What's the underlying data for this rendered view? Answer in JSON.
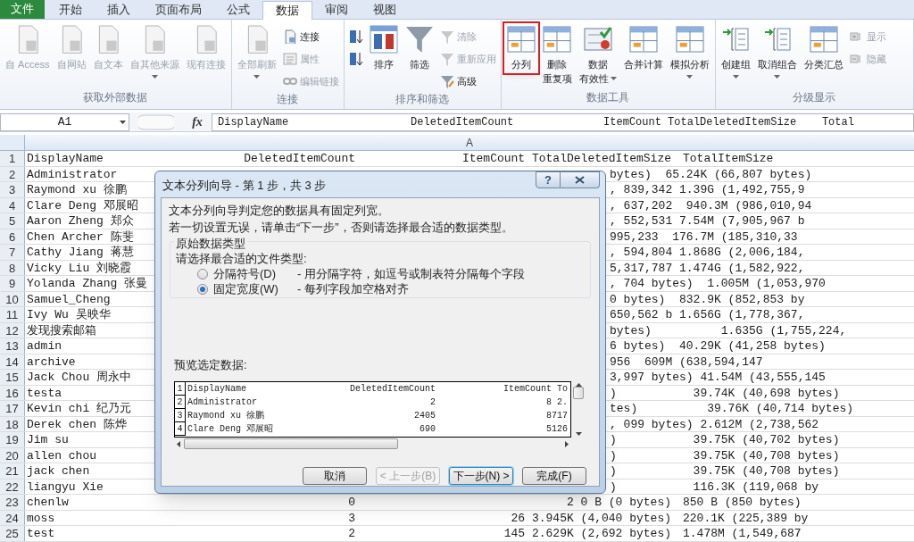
{
  "tabs": [
    {
      "label": "文件",
      "kind": "file",
      "selected": false
    },
    {
      "label": "开始",
      "kind": "tab",
      "selected": false
    },
    {
      "label": "插入",
      "kind": "tab",
      "selected": false
    },
    {
      "label": "页面布局",
      "kind": "tab",
      "selected": false
    },
    {
      "label": "公式",
      "kind": "tab",
      "selected": false
    },
    {
      "label": "数据",
      "kind": "tab",
      "selected": true
    },
    {
      "label": "审阅",
      "kind": "tab",
      "selected": false
    },
    {
      "label": "视图",
      "kind": "tab",
      "selected": false
    }
  ],
  "ribbon_groups": [
    {
      "label": "获取外部数据",
      "buttons": [
        {
          "lines": [
            "自 Access"
          ],
          "kind": "large",
          "disabled": true
        },
        {
          "lines": [
            "自网站"
          ],
          "kind": "large",
          "disabled": true
        },
        {
          "lines": [
            "自文本"
          ],
          "kind": "large",
          "disabled": true
        },
        {
          "lines": [
            "自其他来源"
          ],
          "kind": "large",
          "disabled": true,
          "dropdown": true
        },
        {
          "lines": [
            "现有连接"
          ],
          "kind": "large",
          "disabled": true
        }
      ]
    },
    {
      "label": "连接",
      "buttons": [
        {
          "lines": [
            "全部刷新"
          ],
          "kind": "large",
          "disabled": true,
          "dropdown": true
        },
        {
          "lines": [
            "连接"
          ],
          "kind": "small",
          "disabled": false
        },
        {
          "lines": [
            "属性"
          ],
          "kind": "small",
          "disabled": true
        },
        {
          "lines": [
            "编辑链接"
          ],
          "kind": "small",
          "disabled": true
        }
      ]
    },
    {
      "label": "排序和筛选",
      "buttons": [
        {
          "kind": "small",
          "disabled": false
        },
        {
          "kind": "small",
          "disabled": false
        },
        {
          "lines": [
            "排序"
          ],
          "kind": "large",
          "disabled": false
        },
        {
          "lines": [
            "筛选"
          ],
          "kind": "large",
          "disabled": false
        },
        {
          "lines": [
            "清除"
          ],
          "kind": "small",
          "disabled": true
        },
        {
          "lines": [
            "重新应用"
          ],
          "kind": "small",
          "disabled": true
        },
        {
          "lines": [
            "高级"
          ],
          "kind": "small",
          "disabled": false
        }
      ]
    },
    {
      "label": "数据工具",
      "buttons": [
        {
          "lines": [
            "分列"
          ],
          "kind": "large",
          "disabled": false,
          "highlighted": true
        },
        {
          "lines": [
            "删除",
            "重复项"
          ],
          "kind": "large",
          "disabled": false
        },
        {
          "lines": [
            "数据",
            "有效性"
          ],
          "kind": "large",
          "disabled": false,
          "dropdown": true
        },
        {
          "lines": [
            "合并计算"
          ],
          "kind": "large",
          "disabled": false
        },
        {
          "lines": [
            "模拟分析"
          ],
          "kind": "large",
          "disabled": false,
          "dropdown": true
        }
      ]
    },
    {
      "label": "分级显示",
      "buttons": [
        {
          "lines": [
            "创建组"
          ],
          "kind": "large",
          "disabled": false,
          "dropdown": true
        },
        {
          "lines": [
            "取消组合"
          ],
          "kind": "large",
          "disabled": false,
          "dropdown": true
        },
        {
          "lines": [
            "分类汇总"
          ],
          "kind": "large",
          "disabled": false
        },
        {
          "lines": [
            "显示"
          ],
          "kind": "small",
          "disabled": true
        },
        {
          "lines": [
            "隐藏"
          ],
          "kind": "small",
          "disabled": true
        }
      ]
    }
  ],
  "formula_bar": {
    "name_box": "A1",
    "function_label": "fx",
    "formula": "DisplayName                   DeletedItemCount              ItemCount TotalDeletedItemSize    Total"
  },
  "column_header": "A",
  "rows": [
    {
      "number": "1",
      "kind": "full",
      "name": "DisplayName",
      "deleted": "DeletedItemCount",
      "size": "ItemCount TotalDeletedItemSize",
      "total": "TotalItemSize"
    },
    {
      "number": "2",
      "kind": "split",
      "name": "Administrator",
      "detail": "bytes)  65.24K (66,807 bytes)"
    },
    {
      "number": "3",
      "kind": "split",
      "name": "Raymond xu 徐鹏",
      "detail": ", 839,342 1.39G (1,492,755,9"
    },
    {
      "number": "4",
      "kind": "split",
      "name": "Clare Deng 邓展昭",
      "detail": ", 637,202  940.3M (986,010,94"
    },
    {
      "number": "5",
      "kind": "split",
      "name": "Aaron Zheng 郑众",
      "detail": ", 552,531 7.54M (7,905,967 b"
    },
    {
      "number": "6",
      "kind": "split",
      "name": "Chen Archer 陈斐",
      "detail": "995,233  176.7M (185,310,33"
    },
    {
      "number": "7",
      "kind": "split",
      "name": "Cathy Jiang 蒋慧",
      "detail": ", 594,804 1.868G (2,006,184,"
    },
    {
      "number": "8",
      "kind": "split",
      "name": "Vicky Liu 刘晓霞",
      "detail": "5,317,787 1.474G (1,582,922,"
    },
    {
      "number": "9",
      "kind": "split",
      "name": "Yolanda Zhang 张曼",
      "detail": ", 704 bytes)  1.005M (1,053,970"
    },
    {
      "number": "10",
      "kind": "split",
      "name": "Samuel_Cheng",
      "detail": "0 bytes)  832.9K (852,853 by"
    },
    {
      "number": "11",
      "kind": "split",
      "name": "Ivy Wu 吴映华",
      "detail": "650,562 b 1.656G (1,778,367,"
    },
    {
      "number": "12",
      "kind": "split",
      "name": "发现搜索邮箱",
      "detail": "bytes)          1.635G (1,755,224,"
    },
    {
      "number": "13",
      "kind": "split",
      "name": "admin",
      "detail": "6 bytes)  40.29K (41,258 bytes)"
    },
    {
      "number": "14",
      "kind": "split",
      "name": "archive",
      "detail": "956  609M (638,594,147"
    },
    {
      "number": "15",
      "kind": "split",
      "name": "Jack Chou 周永中",
      "detail": "3,997 bytes) 41.54M (43,555,145"
    },
    {
      "number": "16",
      "kind": "split",
      "name": "testa",
      "detail": ")           39.74K (40,698 bytes)"
    },
    {
      "number": "17",
      "kind": "split",
      "name": "Kevin chi 纪乃元",
      "detail": "tes)          39.76K (40,714 bytes)"
    },
    {
      "number": "18",
      "kind": "split",
      "name": "Derek chen 陈烨",
      "detail": ", 099 bytes) 2.612M (2,738,562"
    },
    {
      "number": "19",
      "kind": "split",
      "name": "Jim su",
      "detail": ")           39.75K (40,702 bytes)"
    },
    {
      "number": "20",
      "kind": "split",
      "name": "allen chou",
      "detail": ")           39.75K (40,708 bytes)"
    },
    {
      "number": "21",
      "kind": "split",
      "name": "jack chen",
      "detail": ")           39.75K (40,708 bytes)"
    },
    {
      "number": "22",
      "kind": "split",
      "name": "liangyu Xie",
      "detail": ")           116.3K (119,068 by"
    },
    {
      "number": "23",
      "kind": "full",
      "name": "chenlw",
      "deleted": "0",
      "size": "2 0 B (0 bytes)",
      "total": "850 B (850 bytes)"
    },
    {
      "number": "24",
      "kind": "full",
      "name": "moss",
      "deleted": "3",
      "size": "26 3.945K (4,040 bytes)",
      "total": "220.1K (225,389 by"
    },
    {
      "number": "25",
      "kind": "full",
      "name": "test",
      "deleted": "2",
      "size": "145 2.629K (2,692 bytes)",
      "total": "1.478M (1,549,687"
    }
  ],
  "dialog": {
    "title": "文本分列向导 - 第 1 步，共 3 步",
    "help": "?",
    "intro": [
      "文本分列向导判定您的数据具有固定列宽。",
      "若一切设置无误，请单击“下一步”，否则请选择最合适的数据类型。"
    ],
    "group_title": "原始数据类型",
    "prompt": "请选择最合适的文件类型:",
    "options": [
      {
        "label": "分隔符号(D)",
        "description": "- 用分隔字符，如逗号或制表符分隔每个字段",
        "selected": false
      },
      {
        "label": "固定宽度(W)",
        "description": "- 每列字段加空格对齐",
        "selected": true
      }
    ],
    "preview_label": "预览选定数据:",
    "preview_rows": [
      {
        "number": "1",
        "name": "DisplayName",
        "deleted": "DeletedItemCount",
        "count": "ItemCount To"
      },
      {
        "number": "2",
        "name": "Administrator",
        "deleted": "2",
        "count": "8 2."
      },
      {
        "number": "3",
        "name": "Raymond xu 徐鹏",
        "deleted": "2405",
        "count": "8717"
      },
      {
        "number": "4",
        "name": "Clare Deng 邓展昭",
        "deleted": "690",
        "count": "5126"
      }
    ],
    "buttons": [
      {
        "label": "取消",
        "disabled": false,
        "default": false
      },
      {
        "label": "< 上一步(B)",
        "disabled": true,
        "default": false
      },
      {
        "label": "下一步(N) >",
        "disabled": false,
        "default": true
      },
      {
        "label": "完成(F)",
        "disabled": false,
        "default": false
      }
    ]
  }
}
